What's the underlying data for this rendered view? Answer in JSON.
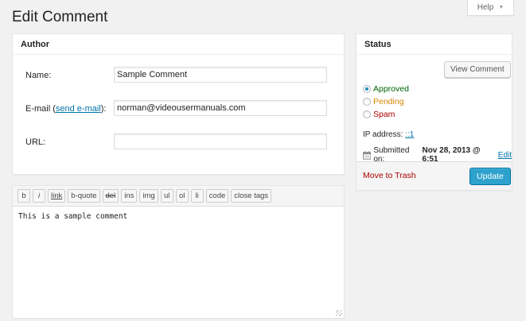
{
  "page": {
    "title": "Edit Comment"
  },
  "help_tab": {
    "label": "Help",
    "icon": "triangle-down-icon"
  },
  "author_box": {
    "title": "Author",
    "name_label": "Name:",
    "name_value": "Sample Comment",
    "email_label_prefix": "E-mail (",
    "email_link": "send e-mail",
    "email_label_suffix": "):",
    "email_value": "norman@videousermanuals.com",
    "url_label": "URL:",
    "url_value": ""
  },
  "editor": {
    "buttons": [
      "b",
      "i",
      "link",
      "b-quote",
      "del",
      "ins",
      "img",
      "ul",
      "ol",
      "li",
      "code",
      "close tags"
    ],
    "content": "This is a sample comment"
  },
  "status_box": {
    "title": "Status",
    "view_comment_label": "View Comment",
    "options": [
      {
        "label": "Approved",
        "checked": true,
        "color": "#006505"
      },
      {
        "label": "Pending",
        "checked": false,
        "color": "#d98500"
      },
      {
        "label": "Spam",
        "checked": false,
        "color": "#a00"
      }
    ],
    "ip_label": "IP address:",
    "ip_value": "::1",
    "submitted_label": "Submitted on:",
    "submitted_value": "Nov 28, 2013 @ 6:51",
    "edit_link": "Edit",
    "trash_label": "Move to Trash",
    "update_label": "Update"
  },
  "colors": {
    "link": "#0073aa",
    "primary_button": "#2ea2cc",
    "trash": "#a00"
  }
}
